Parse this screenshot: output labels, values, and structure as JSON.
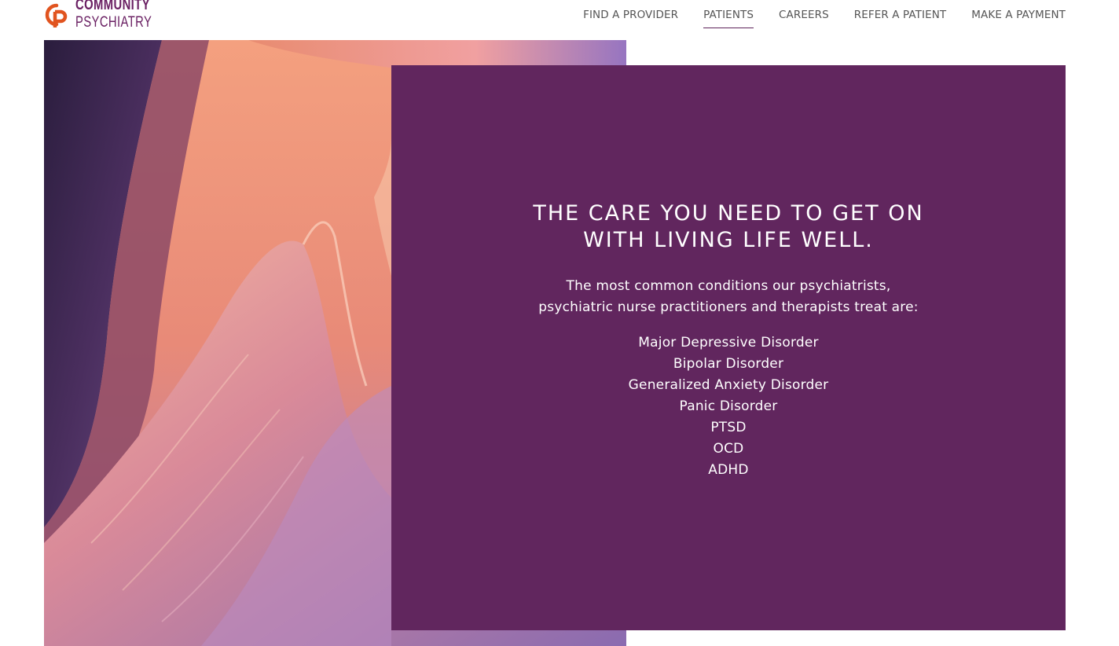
{
  "brand": {
    "line1": "COMMUNITY",
    "line2": "PSYCHIATRY",
    "logo_color": "#6a2063",
    "logo_mark_color": "#e1541f"
  },
  "nav": {
    "items": [
      {
        "label": "FIND A PROVIDER",
        "active": false
      },
      {
        "label": "PATIENTS",
        "active": true
      },
      {
        "label": "CAREERS",
        "active": false
      },
      {
        "label": "REFER A PATIENT",
        "active": false
      },
      {
        "label": "MAKE A PAYMENT",
        "active": false
      }
    ]
  },
  "panel": {
    "bg_color": "#61265e",
    "heading_line1": "THE CARE YOU NEED TO GET ON",
    "heading_line2": "WITH LIVING LIFE WELL.",
    "intro_line1": "The most common conditions our psychiatrists,",
    "intro_line2": "psychiatric nurse practitioners and therapists treat are:",
    "conditions": [
      "Major Depressive Disorder",
      "Bipolar Disorder",
      "Generalized Anxiety Disorder",
      "Panic Disorder",
      "PTSD",
      "OCD",
      "ADHD"
    ]
  },
  "hero": {
    "image_subject": "slot-canyon-photo"
  }
}
